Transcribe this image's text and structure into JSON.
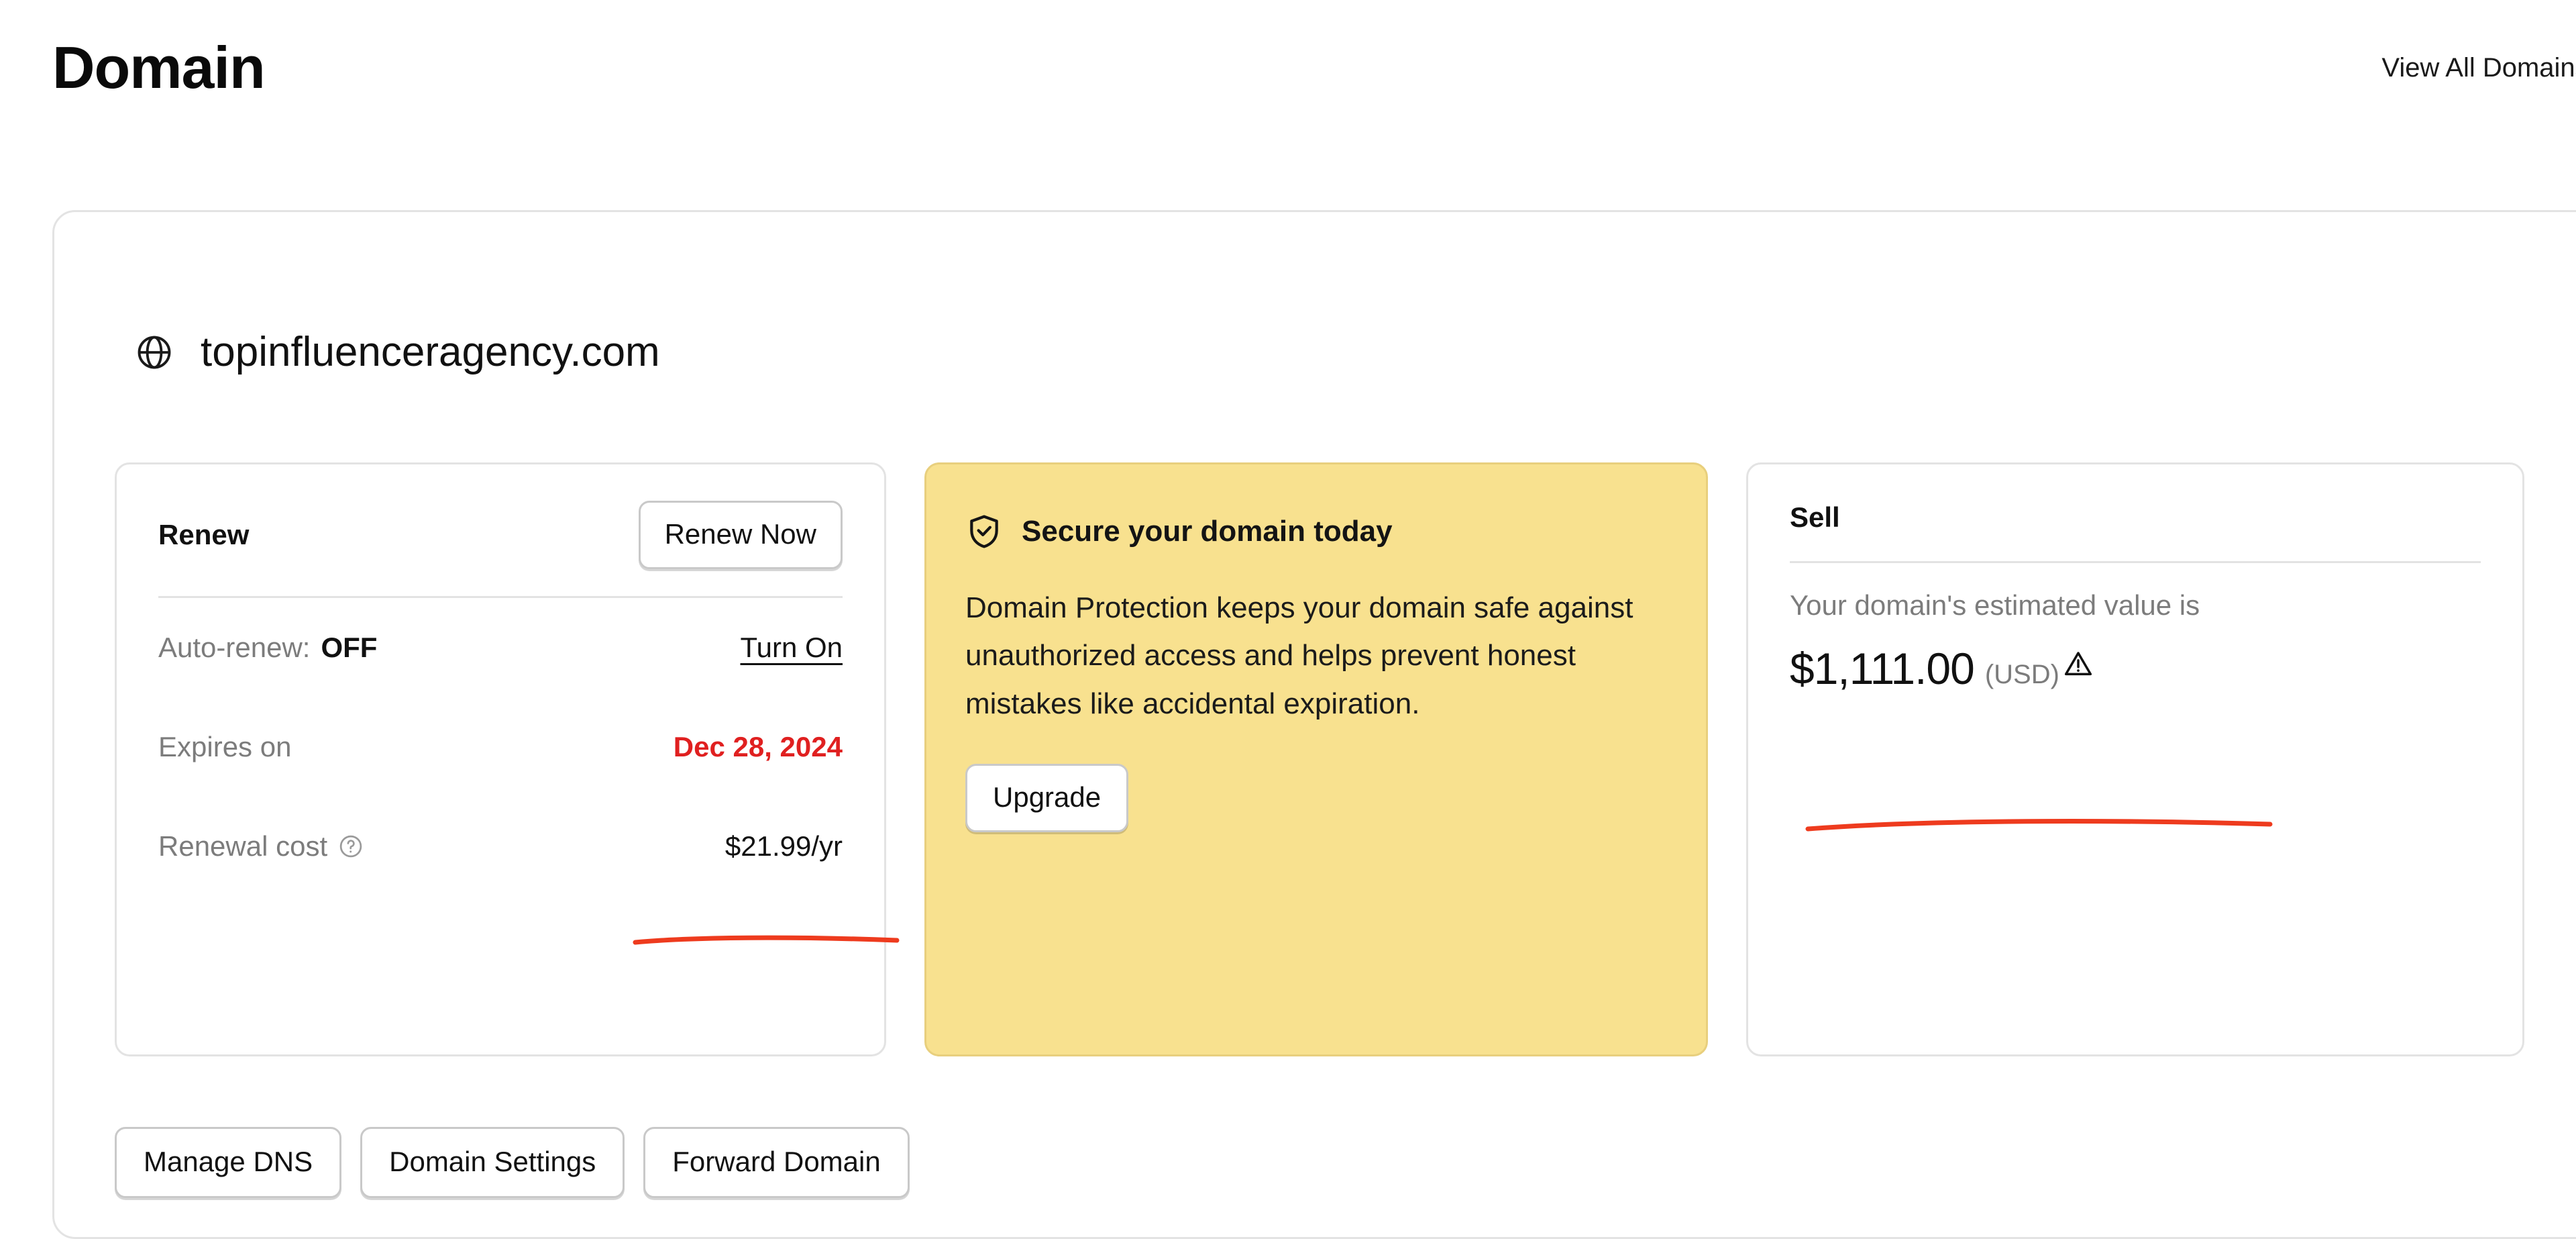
{
  "header": {
    "title": "Domain",
    "view_all_label": "View All Domains",
    "view_all_chevron": "›"
  },
  "domain": {
    "name": "topinfluenceragency.com",
    "globe_icon": "globe-icon"
  },
  "renew_card": {
    "title": "Renew",
    "renew_now_label": "Renew Now",
    "auto_renew_key": "Auto-renew:",
    "auto_renew_value": "OFF",
    "turn_on_label": "Turn On",
    "expires_key": "Expires on",
    "expires_value": "Dec 28, 2024",
    "renewal_cost_key": "Renewal cost",
    "renewal_cost_help_icon": "help-circle-icon",
    "renewal_cost_value": "$21.99/yr"
  },
  "secure_card": {
    "shield_icon": "shield-check-icon",
    "title": "Secure your domain today",
    "body": "Domain Protection keeps your domain safe against unauthorized access and helps prevent honest mistakes like accidental expiration.",
    "upgrade_label": "Upgrade",
    "background_color": "#f8e18f"
  },
  "sell_card": {
    "title": "Sell",
    "subtitle": "Your domain's estimated value is",
    "amount": "$1,111.00",
    "currency": "(USD)",
    "warning_icon": "warning-triangle-icon"
  },
  "bottom_actions": [
    {
      "label": "Manage DNS"
    },
    {
      "label": "Domain Settings"
    },
    {
      "label": "Forward Domain"
    }
  ],
  "annotations": {
    "color": "#ee3b1e",
    "items": [
      {
        "target": "renewal-cost-value"
      },
      {
        "target": "sell-estimated-value"
      }
    ]
  }
}
